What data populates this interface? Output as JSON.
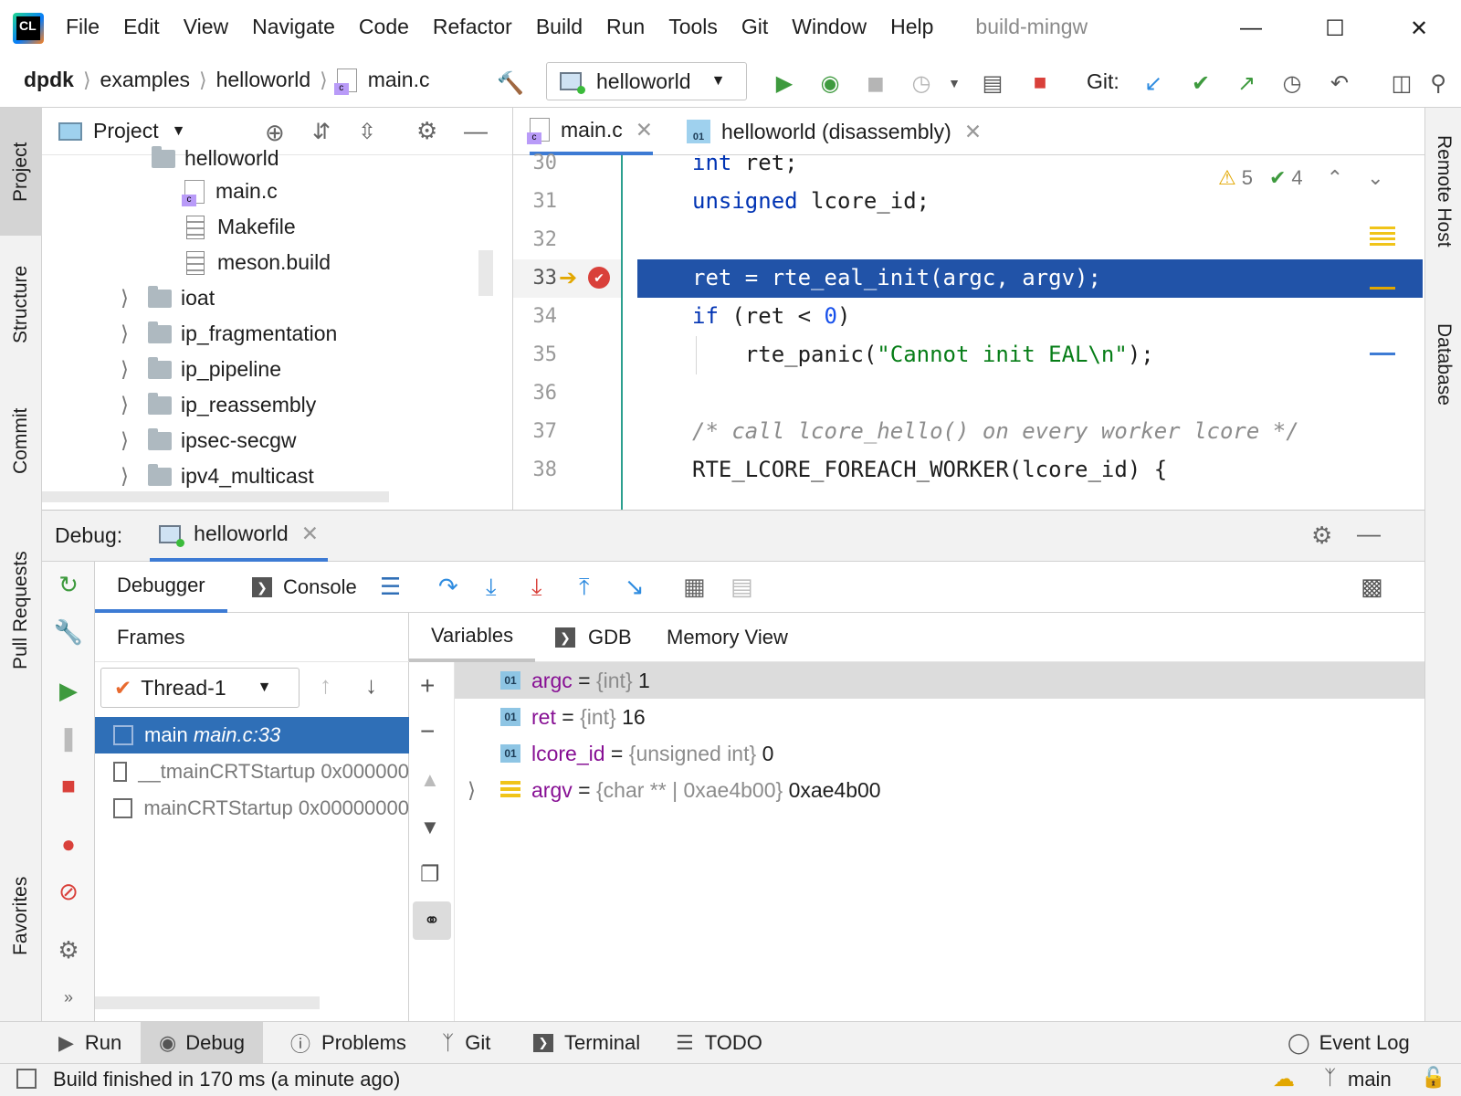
{
  "menu": [
    "File",
    "Edit",
    "View",
    "Navigate",
    "Code",
    "Refactor",
    "Build",
    "Run",
    "Tools",
    "Git",
    "Window",
    "Help"
  ],
  "window_title": "build-mingw",
  "logo_text": "CL",
  "breadcrumb": [
    "dpdk",
    "examples",
    "helloworld",
    "main.c"
  ],
  "run_config": "helloworld",
  "git_label": "Git:",
  "project": {
    "title": "Project",
    "items": [
      {
        "label": "helloworld",
        "type": "folder",
        "open": true
      },
      {
        "label": "main.c",
        "type": "c"
      },
      {
        "label": "Makefile",
        "type": "text"
      },
      {
        "label": "meson.build",
        "type": "text"
      },
      {
        "label": "ioat",
        "type": "folder"
      },
      {
        "label": "ip_fragmentation",
        "type": "folder"
      },
      {
        "label": "ip_pipeline",
        "type": "folder"
      },
      {
        "label": "ip_reassembly",
        "type": "folder"
      },
      {
        "label": "ipsec-secgw",
        "type": "folder"
      },
      {
        "label": "ipv4_multicast",
        "type": "folder"
      }
    ]
  },
  "editor": {
    "tabs": [
      {
        "label": "main.c",
        "active": true
      },
      {
        "label": "helloworld (disassembly)",
        "active": false
      }
    ],
    "warnings": "5",
    "checks": "4",
    "lines": [
      {
        "n": "30",
        "tokens": [
          [
            "kw",
            "int"
          ],
          [
            "",
            "ret;"
          ]
        ]
      },
      {
        "n": "31",
        "tokens": [
          [
            "kw",
            "unsigned"
          ],
          [
            "",
            " lcore_id;"
          ]
        ]
      },
      {
        "n": "32",
        "tokens": []
      },
      {
        "n": "33",
        "tokens": [
          [
            "",
            "ret = rte_eal_init(argc, argv);"
          ]
        ],
        "current": true
      },
      {
        "n": "34",
        "tokens": [
          [
            "kw",
            "if"
          ],
          [
            "",
            " (ret < "
          ],
          [
            "num",
            "0"
          ],
          [
            "",
            ")"
          ]
        ]
      },
      {
        "n": "35",
        "tokens": [
          [
            "",
            "    rte_panic("
          ],
          [
            "str",
            "\"Cannot init EAL\\n\""
          ],
          [
            "",
            ");"
          ]
        ]
      },
      {
        "n": "36",
        "tokens": []
      },
      {
        "n": "37",
        "tokens": [
          [
            "cmt",
            "/* call lcore_hello() on every worker lcore */"
          ]
        ]
      },
      {
        "n": "38",
        "tokens": [
          [
            "",
            "RTE_LCORE_FOREACH_WORKER(lcore_id) {"
          ]
        ]
      }
    ]
  },
  "debug": {
    "label": "Debug:",
    "session": "helloworld",
    "tabs": [
      "Debugger",
      "Console"
    ],
    "frames_label": "Frames",
    "thread": "Thread-1",
    "frames": [
      {
        "fn": "main",
        "loc": "main.c:33",
        "selected": true
      },
      {
        "fn": "__tmainCRTStartup",
        "loc": "0x000000",
        "selected": false
      },
      {
        "fn": "mainCRTStartup",
        "loc": "0x00000000",
        "selected": false
      }
    ],
    "var_tabs": [
      "Variables",
      "GDB",
      "Memory View"
    ],
    "variables": [
      {
        "name": "argc",
        "type": "{int}",
        "value": "1"
      },
      {
        "name": "ret",
        "type": "{int}",
        "value": "16"
      },
      {
        "name": "lcore_id",
        "type": "{unsigned int}",
        "value": "0"
      },
      {
        "name": "argv",
        "type": "{char ** | 0xae4b00}",
        "value": "0xae4b00",
        "expandable": true
      }
    ]
  },
  "left_stripe": [
    "Project",
    "Structure",
    "Commit",
    "Pull Requests",
    "Favorites"
  ],
  "right_stripe": [
    "Remote Host",
    "Database"
  ],
  "bottom_tabs": [
    "Run",
    "Debug",
    "Problems",
    "Git",
    "Terminal",
    "TODO"
  ],
  "event_log": "Event Log",
  "status": "Build finished in 170 ms (a minute ago)",
  "branch": "main"
}
